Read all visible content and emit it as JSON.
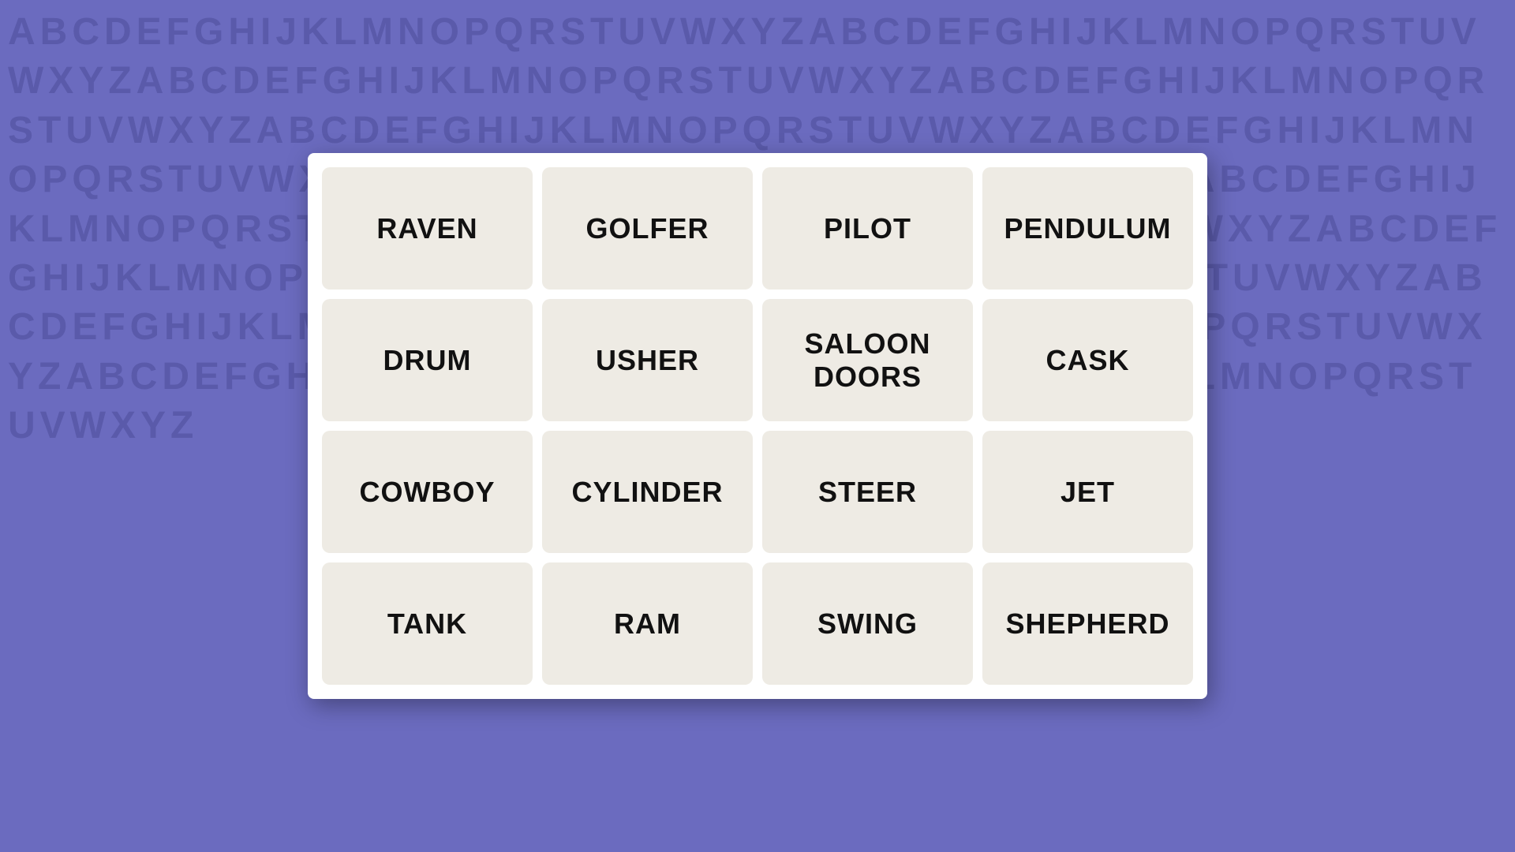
{
  "background": {
    "alphabet_text": "ABCDEFGHIJKLMNOPQRSTUVWXYZABCDEFGHIJKLMNOPQRSTUVWXYZABCDEFGHIJKLMNOPQRSTUVWXYZABCDEFGHIJKLMNOPQRSTUVWXYZABCDEFGHIJKLMNOPQRSTUVWXYZABCDEFGHIJKLMNOPQRSTUVWXYZABCDEFGHIJKLMNOPQRSTUVWXYZABCDEFGHIJKLMNOPQRSTUVWXYZABCDEFGHIJKLMNOPQRSTUVWXYZABCDEFGHIJKLMNOPQRSTUVWXYZABCDEFGHIJKLMNOPQRSTUVWXYZABCDEFGHIJKLMNOPQRSTUVWXYZABCDEFGHIJKLMNOPQRSTUVWXYZABCDEFGHIJKLMNOPQRSTUVWXYZABCDEFGHIJKLMNOPQRSTUVWXYZ"
  },
  "grid": {
    "cards": [
      {
        "id": "raven",
        "label": "RAVEN"
      },
      {
        "id": "golfer",
        "label": "GOLFER"
      },
      {
        "id": "pilot",
        "label": "PILOT"
      },
      {
        "id": "pendulum",
        "label": "PENDULUM"
      },
      {
        "id": "drum",
        "label": "DRUM"
      },
      {
        "id": "usher",
        "label": "USHER"
      },
      {
        "id": "saloon-doors",
        "label": "SALOON DOORS"
      },
      {
        "id": "cask",
        "label": "CASK"
      },
      {
        "id": "cowboy",
        "label": "COWBOY"
      },
      {
        "id": "cylinder",
        "label": "CYLINDER"
      },
      {
        "id": "steer",
        "label": "STEER"
      },
      {
        "id": "jet",
        "label": "JET"
      },
      {
        "id": "tank",
        "label": "TANK"
      },
      {
        "id": "ram",
        "label": "RAM"
      },
      {
        "id": "swing",
        "label": "SWING"
      },
      {
        "id": "shepherd",
        "label": "SHEPHERD"
      }
    ]
  }
}
